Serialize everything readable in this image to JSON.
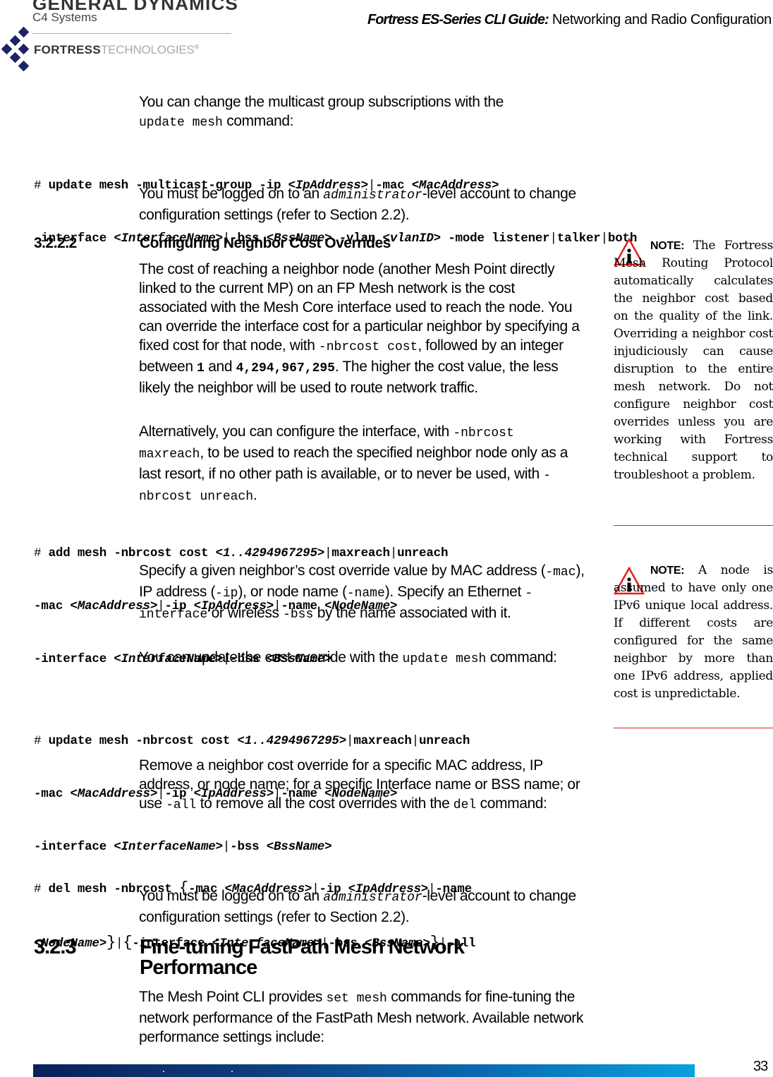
{
  "header": {
    "logo_gd_top": "GENERAL DYNAMICS",
    "logo_gd_sub": "C4 Systems",
    "logo_fortress_bold": "FORTRESS",
    "logo_fortress_light": "TECHNOLOGIES",
    "logo_registered": "®",
    "guide_title_italic": "Fortress ES-Series CLI Guide:",
    "guide_title_rest": " Networking and Radio Configuration"
  },
  "intro": {
    "line1": "You can change the multicast group subscriptions with the",
    "code": "update mesh",
    "line2_tail": " command:"
  },
  "cmd_multicast": {
    "hash": "# ",
    "l1": [
      "update mesh -multicast-group -ip ",
      "<IpAddress>",
      "|",
      "-mac ",
      "<MacAddress>"
    ],
    "l2": [
      "-interface ",
      "<InterfaceName>",
      "|",
      "-bss ",
      "<BssName>",
      " -vlan ",
      "<vlanID>",
      " -mode listener",
      "|",
      "talker",
      "|",
      "both"
    ]
  },
  "admin_note_1": {
    "pre": "You must be logged on to an ",
    "code": "administrator",
    "post": "-level account to change configuration settings (refer to Section 2.2)."
  },
  "section_3222": {
    "number": "3.2.2.2",
    "title": "Configuring Neighbor Cost Overrides"
  },
  "para_cost": {
    "t1": "The cost of reaching a neighbor node (another Mesh Point directly linked to the current MP) on an FP Mesh network is the cost associated with the Mesh Core interface used to reach the node. You can override the interface cost for a particular neighbor by specifying a fixed cost for that node, with ",
    "c1": "-nbrcost cost",
    "t2": ", followed by an integer between ",
    "c2": "1",
    "t3": " and ",
    "c3": "4,294,967,295",
    "t4": ". The higher the cost value, the less likely the neighbor will be used to route network traffic."
  },
  "para_alt": {
    "t1": "Alternatively, you can configure the interface, with ",
    "c1": "-nbrcost maxreach",
    "t2": ", to be used to reach the specified neighbor node only as a last resort, if no other path is available, or to never be used, with ",
    "c2": "-nbrcost unreach",
    "t3": "."
  },
  "cmd_add": {
    "hash": "# ",
    "l1": [
      "add mesh -nbrcost cost ",
      "<1..4294967295>",
      "|",
      "maxreach",
      "|",
      "unreach"
    ],
    "l2": [
      "-mac ",
      "<MacAddress>",
      "|",
      "-ip ",
      "<IpAddress>",
      "|",
      "-name ",
      "<NodeName>"
    ],
    "l3": [
      "-interface ",
      "<InterfaceName>",
      "|",
      "-bss ",
      "<BssName>"
    ]
  },
  "para_specify": {
    "t1": "Specify a given neighbor’s cost override value by MAC address (",
    "c1": "-mac",
    "t2": "), IP address (",
    "c2": "-ip",
    "t3": "), or node name (",
    "c3": "-name",
    "t4": "). Specify an Ethernet ",
    "c4": "-interface",
    "t5": " or wireless ",
    "c5": "-bss",
    "t6": " by the name associated with it."
  },
  "para_update": {
    "t1": "You can update the cost override with the ",
    "c1": "update mesh",
    "t2": " command:"
  },
  "cmd_update": {
    "hash": "# ",
    "l1": [
      "update mesh -nbrcost cost ",
      "<1..4294967295>",
      "|",
      "maxreach",
      "|",
      "unreach"
    ],
    "l2": [
      "-mac ",
      "<MacAddress>",
      "|",
      "-ip ",
      "<IpAddress>",
      "|",
      "-name ",
      "<NodeName>"
    ],
    "l3": [
      "-interface ",
      "<InterfaceName>",
      "|",
      "-bss ",
      "<BssName>"
    ]
  },
  "para_remove": {
    "t1": "Remove a neighbor cost override for a specific MAC address, IP address, or node name; for a specific Interface name or BSS name; or use ",
    "c1": "-all",
    "t2": " to remove all the cost overrides with the ",
    "c2": "del",
    "t3": " command:"
  },
  "cmd_del": {
    "hash": "# ",
    "l1": [
      "del mesh -nbrcost ",
      "{",
      "-mac ",
      "<MacAddress>",
      "|",
      "-ip ",
      "<IpAddress>",
      "|",
      "-name"
    ],
    "l2": [
      "<NodeName>",
      "}",
      "|",
      "{",
      "-interface ",
      "<InterfaceName>",
      "|",
      "-bss ",
      "<BssName>",
      "}",
      "|",
      "-all"
    ]
  },
  "admin_note_2": {
    "pre": "You must be logged on to an ",
    "code": "administrator",
    "post": "-level account to change configuration settings (refer to Section 2.2)."
  },
  "section_323": {
    "number": "3.2.3",
    "title": "Fine-tuning FastPath Mesh Network Performance"
  },
  "para_finetune": {
    "t1": "The Mesh Point CLI provides ",
    "c1": "set mesh",
    "t2": " commands for fine-tuning the network performance of the FastPath Mesh network. Available network performance settings include:"
  },
  "notes": [
    {
      "label": "NOTE:",
      "text": " The Fortress Mesh Routing Protocol automatically calculates the neighbor cost based on the quality of the link. Overriding a neighbor cost injudiciously can cause disruption to the entire mesh network. Do not configure neighbor cost overrides unless you are working with Fortress technical support to troubleshoot a problem."
    },
    {
      "label": "NOTE:",
      "text": " A node is assumed to have only one IPv6 unique local address. If different costs are configured for the same neighbor by more than one IPv6 address, applied cost is unpredictable."
    }
  ],
  "footer": {
    "page_number": "33"
  },
  "colors": {
    "logo_navy": "#1b2466",
    "note_red": "#e02020",
    "footer_bar_start": "#0a2a60",
    "footer_bar_end": "#0a9ad8"
  }
}
